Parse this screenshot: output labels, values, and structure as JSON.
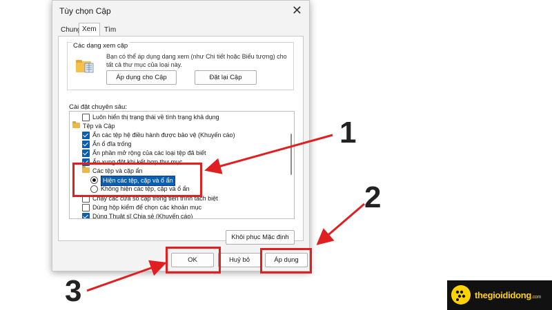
{
  "dialog": {
    "title": "Tùy chọn Cập",
    "close_glyph": "✕",
    "tabs": [
      {
        "label": "Chung"
      },
      {
        "label": "Xem"
      },
      {
        "label": "Tìm kiếm"
      }
    ],
    "active_tab": "Xem",
    "folder_views": {
      "group_label": "Các dạng xem cặp",
      "description": "Bạn có thể áp dụng dạng xem (như Chi tiết hoặc Biểu tượng) cho tất cả thư mục của loại này.",
      "apply_button": "Áp dụng cho Cập",
      "reset_button": "Đặt lại Cập"
    },
    "advanced_label": "Cài đặt chuyên sâu:",
    "tree": [
      {
        "kind": "checkbox",
        "checked": false,
        "label": "Luôn hiển thị trạng thái về tình trạng khả dụng"
      },
      {
        "kind": "folder",
        "label": "Tệp và Cập"
      },
      {
        "kind": "checkbox",
        "checked": true,
        "label": "Ẩn các tệp hệ điều hành được bảo vệ (Khuyến cáo)"
      },
      {
        "kind": "checkbox",
        "checked": true,
        "label": "Ẩn ổ đĩa trống"
      },
      {
        "kind": "checkbox",
        "checked": true,
        "label": "Ẩn phần mở rộng của các loại tệp đã biết"
      },
      {
        "kind": "checkbox",
        "checked": true,
        "label": "Ẩn xung đột khi kết hợp thư mục"
      },
      {
        "kind": "folder",
        "label": "Các tệp và cặp ẩn"
      },
      {
        "kind": "radio",
        "checked": true,
        "selected": true,
        "label": "Hiện các tệp, cặp và ổ ẩn"
      },
      {
        "kind": "radio",
        "checked": false,
        "label": "Không hiện các tệp, cặp và ổ ẩn"
      },
      {
        "kind": "checkbox",
        "checked": false,
        "label": "Chạy các cửa sổ cặp trong tiến trình tách biệt"
      },
      {
        "kind": "checkbox",
        "checked": false,
        "label": "Dùng hộp kiểm để chọn các khoản mục"
      },
      {
        "kind": "checkbox",
        "checked": true,
        "label": "Dùng Thuật sĩ Chia sẻ (Khuyến cáo)"
      }
    ],
    "restore_button": "Khôi phục Mặc định",
    "ok_button": "OK",
    "cancel_button": "Huỷ bỏ",
    "apply_button": "Áp dụng"
  },
  "annotations": {
    "step1": "1",
    "step2": "2",
    "step3": "3",
    "color": "#e02020"
  },
  "brand": {
    "name": "thegioididong",
    "suffix": ".com",
    "color": "#ffd200"
  }
}
